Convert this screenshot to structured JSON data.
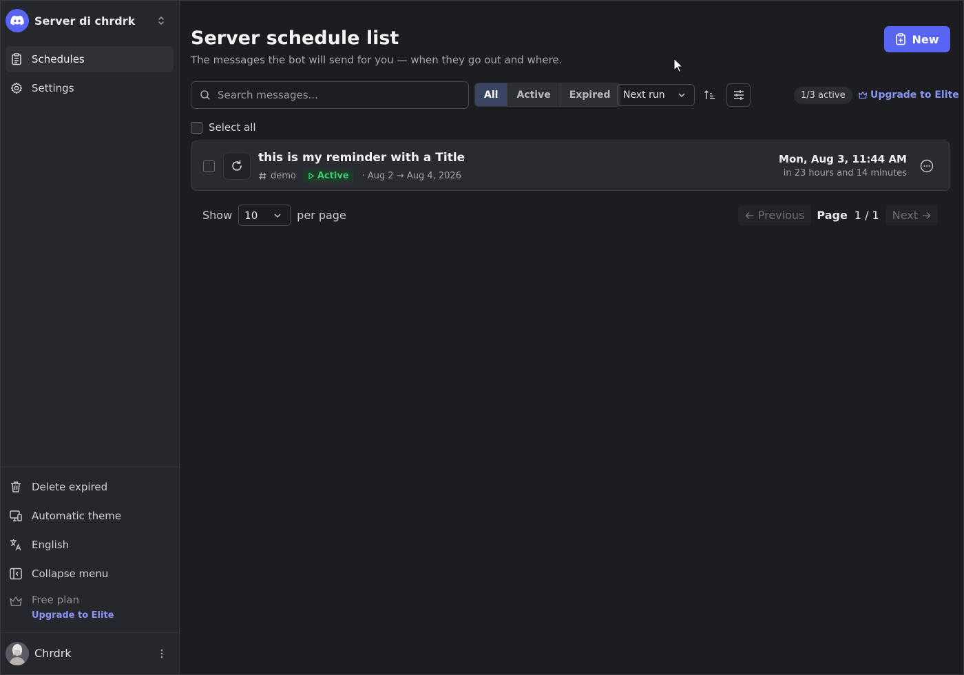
{
  "sidebar": {
    "server_name": "Server di chrdrk",
    "nav": [
      {
        "label": "Schedules",
        "icon": "clipboard-icon",
        "active": true
      },
      {
        "label": "Settings",
        "icon": "gear-icon",
        "active": false
      }
    ],
    "bottom_items": [
      {
        "label": "Delete expired",
        "icon": "trash-icon"
      },
      {
        "label": "Automatic theme",
        "icon": "monitor-icon"
      },
      {
        "label": "English",
        "icon": "language-icon"
      },
      {
        "label": "Collapse menu",
        "icon": "collapse-sidebar-icon"
      }
    ],
    "plan": {
      "label": "Free plan",
      "upgrade_label": "Upgrade to Elite"
    },
    "user": {
      "name": "Chrdrk"
    }
  },
  "header": {
    "title": "Server schedule list",
    "subtitle": "The messages the bot will send for you — when they go out and where.",
    "new_button": "New"
  },
  "toolbar": {
    "search_placeholder": "Search messages...",
    "filters": [
      "All",
      "Active",
      "Expired"
    ],
    "active_filter": "All",
    "sort_value": "Next run",
    "quota": "1/3 active",
    "upgrade_label": "Upgrade to Elite"
  },
  "list": {
    "select_all_label": "Select all",
    "items": [
      {
        "title": "this is my reminder with a Title",
        "channel": "demo",
        "status": "Active",
        "range": "· Aug 2 → Aug 4, 2026",
        "next_run": "Mon, Aug 3, 11:44 AM",
        "relative": "in 23 hours and 14 minutes"
      }
    ]
  },
  "pagination": {
    "show_label": "Show",
    "per_page_value": "10",
    "per_page_label": "per page",
    "previous_label": "Previous",
    "page_label": "Page",
    "page_count": "1 / 1",
    "next_label": "Next"
  },
  "colors": {
    "accent": "#5865f2",
    "link": "#8b95f5",
    "active_green": "#3fcb74",
    "background": "#1c1d21",
    "sidebar": "#26272c"
  }
}
